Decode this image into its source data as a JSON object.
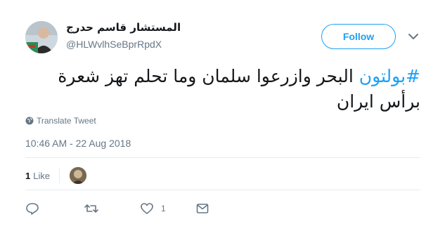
{
  "author": {
    "display_name": "المستشار قاسم حدرج",
    "handle": "@HLWvlhSeBprRpdX",
    "avatar": "avatar-image"
  },
  "follow_label": "Follow",
  "tweet": {
    "hashtag": "#بولتون",
    "text": " البحر وازرعوا سلمان وما تحلم تهز شعرة برأس ايران"
  },
  "translate_label": "Translate Tweet",
  "timestamp": "10:46 AM - 22 Aug 2018",
  "likes": {
    "count": "1",
    "label": "Like"
  },
  "actions": {
    "reply_icon": "reply-icon",
    "retweet_icon": "retweet-icon",
    "like_icon": "heart-icon",
    "like_count": "1",
    "dm_icon": "envelope-icon"
  },
  "colors": {
    "accent": "#1da1f2",
    "secondary_text": "#657786",
    "divider": "#e6ecf0"
  }
}
